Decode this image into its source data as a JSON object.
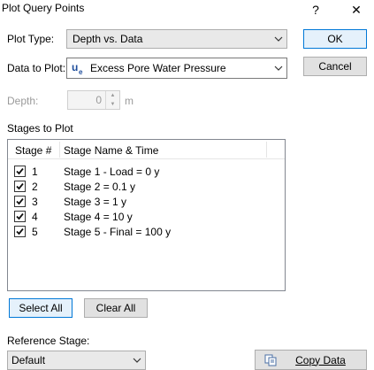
{
  "window": {
    "title": "Plot Query Points",
    "help_glyph": "?",
    "close_glyph": "✕"
  },
  "form": {
    "plot_type_label": "Plot Type:",
    "plot_type_value": "Depth vs. Data",
    "data_to_plot_label": "Data to Plot:",
    "data_to_plot_value": "Excess Pore Water Pressure",
    "data_icon": "pore-pressure-icon",
    "depth_label": "Depth:",
    "depth_value": "0",
    "depth_unit": "m"
  },
  "buttons": {
    "ok": "OK",
    "cancel": "Cancel",
    "select_all": "Select All",
    "clear_all": "Clear All",
    "copy_data": "Copy Data"
  },
  "stages": {
    "section_label": "Stages to Plot",
    "columns": [
      "Stage #",
      "Stage Name & Time"
    ],
    "rows": [
      {
        "number": "1",
        "name": "Stage 1 - Load = 0 y",
        "checked": true
      },
      {
        "number": "2",
        "name": "Stage 2 = 0.1 y",
        "checked": true
      },
      {
        "number": "3",
        "name": "Stage 3 = 1 y",
        "checked": true
      },
      {
        "number": "4",
        "name": "Stage 4 = 10 y",
        "checked": true
      },
      {
        "number": "5",
        "name": "Stage 5 - Final = 100 y",
        "checked": true
      }
    ]
  },
  "reference": {
    "label": "Reference Stage:",
    "value": "Default"
  },
  "colors": {
    "accent": "#0078d7",
    "icon_blue": "#1f4e9c"
  }
}
